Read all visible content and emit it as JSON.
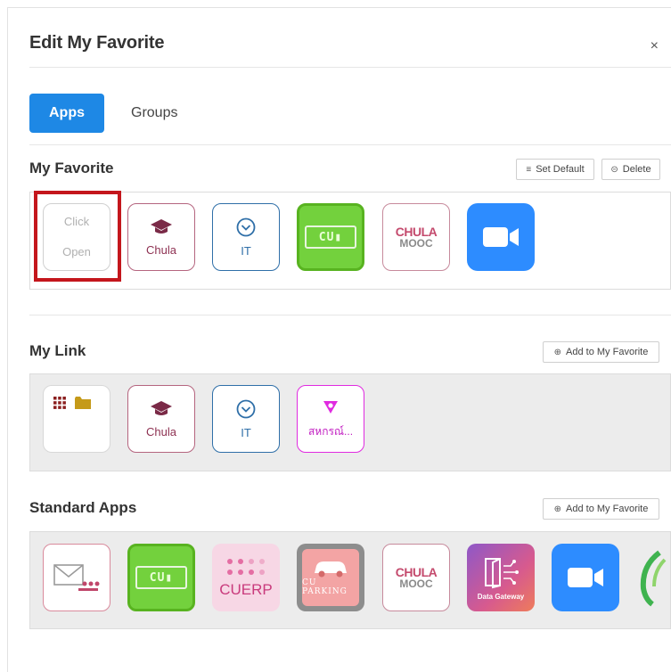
{
  "dialog": {
    "title": "Edit My Favorite",
    "close_label": "×"
  },
  "tabs": [
    {
      "label": "Apps",
      "active": true
    },
    {
      "label": "Groups",
      "active": false
    }
  ],
  "my_favorite": {
    "title": "My Favorite",
    "set_default_label": "Set Default",
    "delete_label": "Delete",
    "placeholder": {
      "line1": "Click",
      "line2": "Open"
    },
    "tiles": [
      {
        "type": "chula",
        "label": "Chula"
      },
      {
        "type": "it",
        "label": "IT"
      },
      {
        "type": "cu-learn",
        "label": ""
      },
      {
        "type": "chula-mooc",
        "label": "CHULA MOOC"
      },
      {
        "type": "zoom",
        "label": ""
      }
    ]
  },
  "my_link": {
    "title": "My Link",
    "add_label": "Add to My Favorite",
    "tiles": [
      {
        "type": "folder",
        "label": ""
      },
      {
        "type": "chula",
        "label": "Chula"
      },
      {
        "type": "it",
        "label": "IT"
      },
      {
        "type": "coop",
        "label": "สหกรณ์..."
      }
    ]
  },
  "standard_apps": {
    "title": "Standard Apps",
    "add_label": "Add to My Favorite",
    "tiles": [
      {
        "type": "mail",
        "label": ""
      },
      {
        "type": "cu-learn",
        "label": ""
      },
      {
        "type": "cuerp",
        "label": "CUERP"
      },
      {
        "type": "parking",
        "label": "CU PARKING"
      },
      {
        "type": "chula-mooc",
        "label": "CHULA MOOC"
      },
      {
        "type": "data-gateway",
        "label": "Data Gateway"
      },
      {
        "type": "zoom",
        "label": ""
      }
    ]
  },
  "colors": {
    "accent": "#1e88e5",
    "highlight": "#c4161c",
    "zoom": "#2d8cff",
    "cu_green": "#73d13d"
  }
}
